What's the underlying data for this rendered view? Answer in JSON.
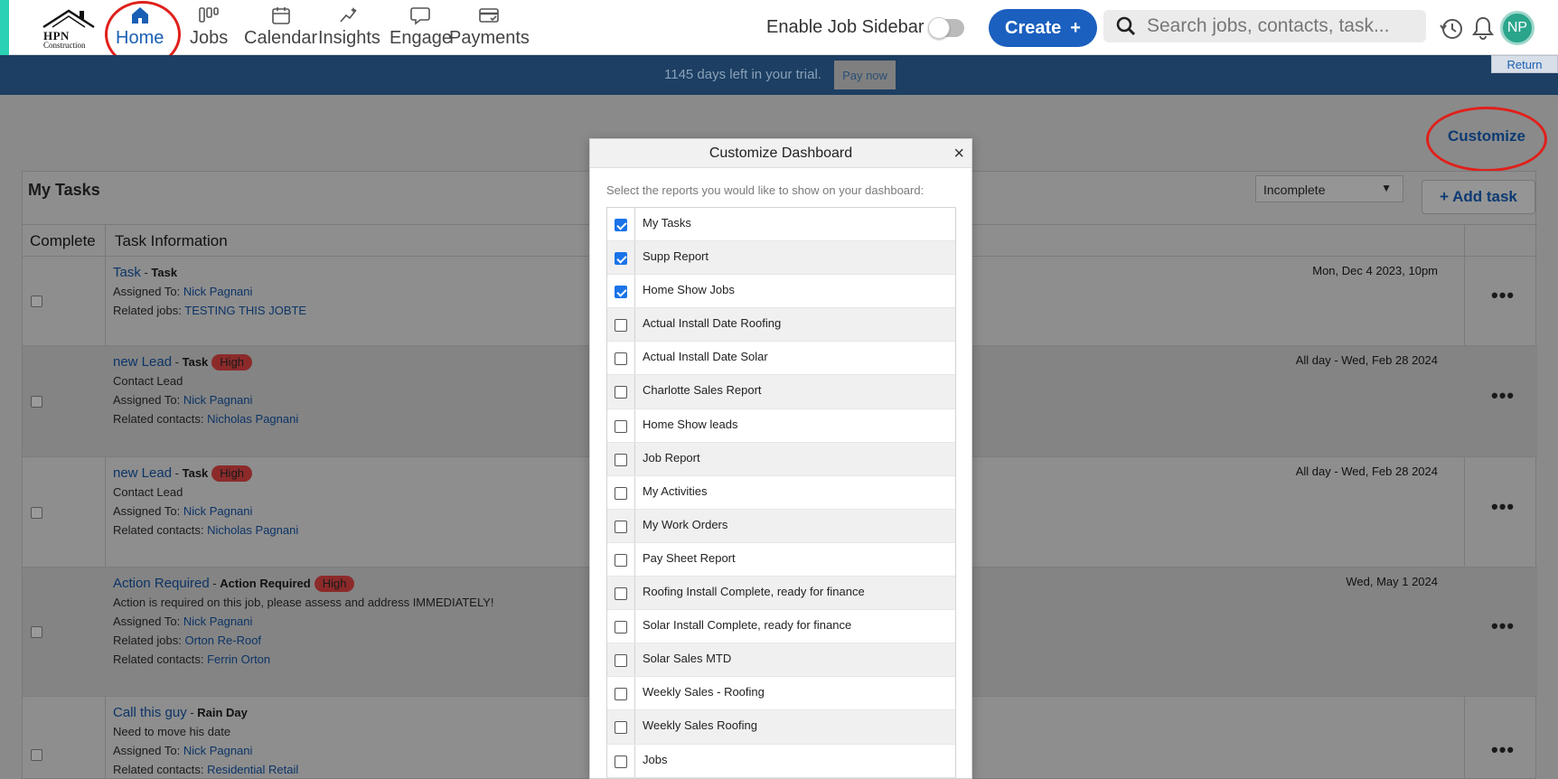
{
  "nav": {
    "logo": {
      "line1": "HPN",
      "line2": "Construction"
    },
    "items": [
      {
        "label": "Home",
        "icon": "home-icon"
      },
      {
        "label": "Jobs",
        "icon": "jobs-icon"
      },
      {
        "label": "Calendar",
        "icon": "calendar-icon"
      },
      {
        "label": "Insights",
        "icon": "insights-icon"
      },
      {
        "label": "Engage",
        "icon": "engage-icon"
      },
      {
        "label": "Payments",
        "icon": "payments-icon"
      }
    ],
    "sidebar_toggle_label": "Enable Job Sidebar",
    "sidebar_toggle_on": false,
    "create_label": "Create",
    "create_plus": "+",
    "search_placeholder": "Search jobs, contacts, task...",
    "avatar_initials": "NP"
  },
  "banner": {
    "message": "1145 days left in your trial.",
    "pay_now": "Pay now",
    "return": "Return"
  },
  "dashboard": {
    "customize_label": "Customize",
    "panel_title": "My Tasks",
    "filter_value": "Incomplete",
    "filter_caret": "▼",
    "add_task_label": "+ Add task",
    "columns": {
      "complete": "Complete",
      "info": "Task Information"
    },
    "tasks": [
      {
        "title": "Task",
        "sep": " - ",
        "type": "Task",
        "priority": "",
        "desc": "",
        "assigned_label": "Assigned To: ",
        "assigned": "Nick Pagnani",
        "related_label": "Related jobs: ",
        "related": "TESTING THIS JOBTE",
        "related2_label": "",
        "related2": "",
        "due": "Mon, Dec 4 2023, 10pm"
      },
      {
        "title": "new Lead",
        "sep": " - ",
        "type": "Task",
        "priority": "High",
        "desc": "Contact Lead",
        "assigned_label": "Assigned To: ",
        "assigned": "Nick Pagnani",
        "related_label": "Related contacts: ",
        "related": "Nicholas Pagnani",
        "related2_label": "",
        "related2": "",
        "due": "All day - Wed, Feb 28 2024"
      },
      {
        "title": "new Lead",
        "sep": " - ",
        "type": "Task",
        "priority": "High",
        "desc": "Contact Lead",
        "assigned_label": "Assigned To: ",
        "assigned": "Nick Pagnani",
        "related_label": "Related contacts: ",
        "related": "Nicholas Pagnani",
        "related2_label": "",
        "related2": "",
        "due": "All day - Wed, Feb 28 2024"
      },
      {
        "title": "Action Required",
        "sep": " - ",
        "type": "Action Required",
        "priority": "High",
        "desc": "Action is required on this job, please assess and address IMMEDIATELY!",
        "assigned_label": "Assigned To: ",
        "assigned": "Nick Pagnani",
        "related_label": "Related jobs: ",
        "related": "Orton Re-Roof",
        "related2_label": "Related contacts: ",
        "related2": "Ferrin Orton",
        "due": "Wed, May 1 2024"
      },
      {
        "title": "Call this guy",
        "sep": " - ",
        "type": "Rain Day",
        "priority": "",
        "desc": "Need to move his date",
        "assigned_label": "Assigned To: ",
        "assigned": "Nick Pagnani",
        "related_label": "Related contacts: ",
        "related": "Residential Retail",
        "related2_label": "",
        "related2": "",
        "due": ""
      }
    ],
    "more_glyph": "•••"
  },
  "modal": {
    "title": "Customize Dashboard",
    "close": "×",
    "instruction": "Select the reports you would like to show on your dashboard:",
    "reports": [
      {
        "label": "My Tasks",
        "checked": true
      },
      {
        "label": "Supp Report",
        "checked": true
      },
      {
        "label": "Home Show Jobs",
        "checked": true
      },
      {
        "label": "Actual Install Date Roofing",
        "checked": false
      },
      {
        "label": "Actual Install Date Solar",
        "checked": false
      },
      {
        "label": "Charlotte Sales Report",
        "checked": false
      },
      {
        "label": "Home Show leads",
        "checked": false
      },
      {
        "label": "Job Report",
        "checked": false
      },
      {
        "label": "My Activities",
        "checked": false
      },
      {
        "label": "My Work Orders",
        "checked": false
      },
      {
        "label": "Pay Sheet Report",
        "checked": false
      },
      {
        "label": "Roofing Install Complete, ready for finance",
        "checked": false
      },
      {
        "label": "Solar Install Complete, ready for finance",
        "checked": false
      },
      {
        "label": "Solar Sales MTD",
        "checked": false
      },
      {
        "label": "Weekly Sales - Roofing",
        "checked": false
      },
      {
        "label": "Weekly Sales Roofing",
        "checked": false
      },
      {
        "label": "Jobs",
        "checked": false
      }
    ]
  },
  "colors": {
    "brand_blue": "#1b5fbf",
    "banner": "#1c3f63",
    "annotation_red": "#e0201b",
    "priority_high": "#8c2a2a"
  }
}
